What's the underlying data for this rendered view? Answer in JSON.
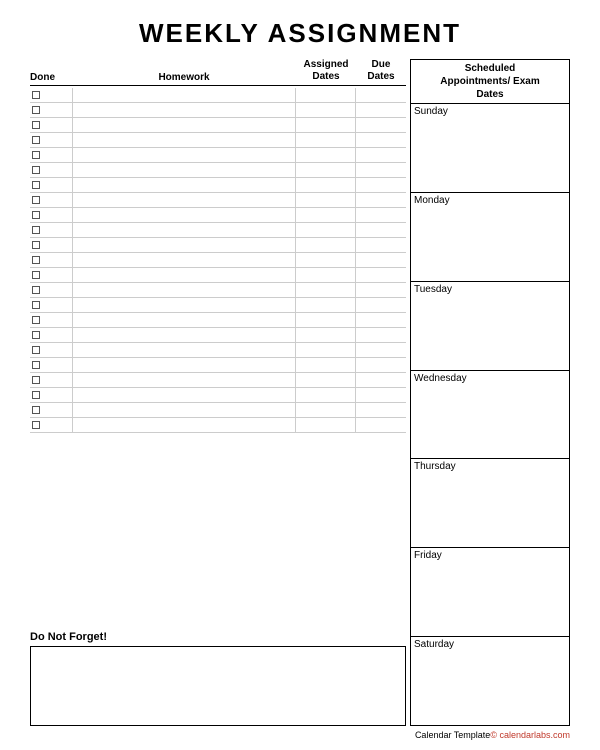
{
  "title": "WEEKLY ASSIGNMENT",
  "columns": {
    "done": "Done",
    "homework": "Homework",
    "assigned_dates": "Assigned\nDates",
    "due_dates": "Due\nDates",
    "scheduled": "Scheduled\nAppointments/ Exam\nDates"
  },
  "days": [
    "Sunday",
    "Monday",
    "Tuesday",
    "Wednesday",
    "Thursday",
    "Friday",
    "Saturday"
  ],
  "dnf_label": "Do Not Forget!",
  "footer": "Calendar Template© calendarlabs.com",
  "num_rows": 23
}
